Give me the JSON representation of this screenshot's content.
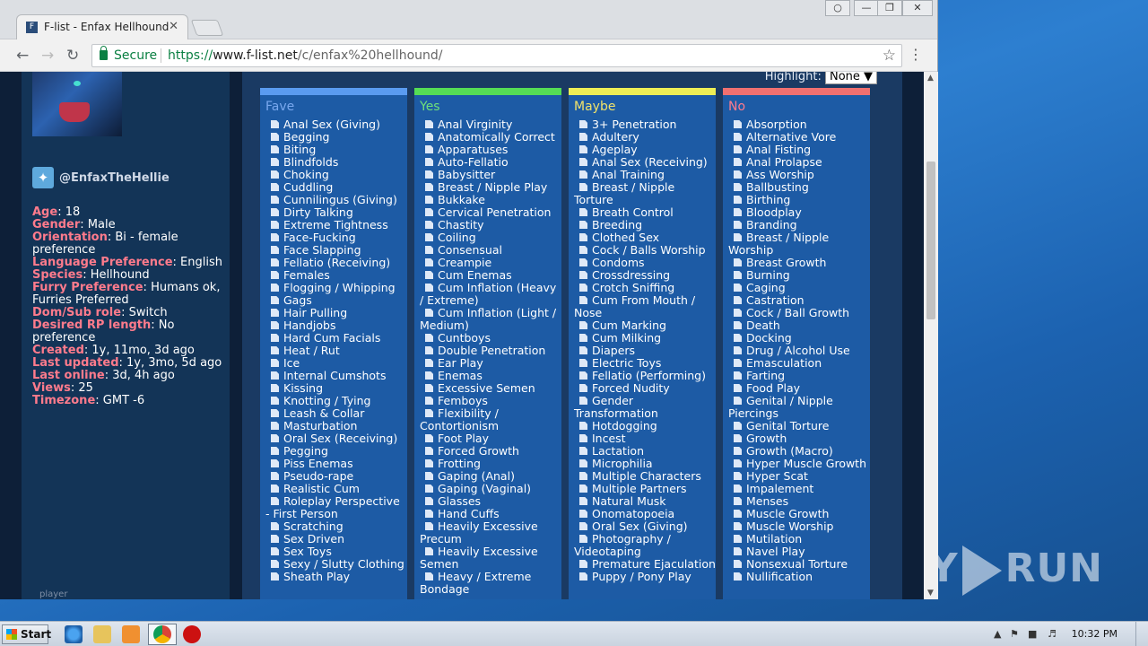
{
  "browser": {
    "tab_title": "F-list - Enfax Hellhound",
    "tab_close": "✕",
    "secure_label": "Secure",
    "url_scheme": "https://",
    "url_host": "www.f-list.net",
    "url_path": "/c/enfax%20hellhound/"
  },
  "sidebar": {
    "twitter_handle": "@EnfaxTheHellie",
    "info": [
      {
        "key": "Age",
        "value": "18"
      },
      {
        "key": "Gender",
        "value": "Male"
      },
      {
        "key": "Orientation",
        "value": "Bi - female preference"
      },
      {
        "key": "Language Preference",
        "value": "English"
      },
      {
        "key": "Species",
        "value": "Hellhound"
      },
      {
        "key": "Furry Preference",
        "value": "Humans ok, Furries Preferred"
      },
      {
        "key": "Dom/Sub role",
        "value": "Switch"
      },
      {
        "key": "Desired RP length",
        "value": "No preference"
      },
      {
        "key": "Created",
        "value": "1y, 11mo, 3d ago"
      },
      {
        "key": "Last updated",
        "value": "1y, 3mo, 5d ago"
      },
      {
        "key": "Last online",
        "value": "3d, 4h ago"
      },
      {
        "key": "Views",
        "value": "25"
      },
      {
        "key": "Timezone",
        "value": "GMT -6"
      }
    ],
    "player_caption": "player"
  },
  "highlight": {
    "label": "Highlight:",
    "value": "None"
  },
  "columns": [
    {
      "title": "Fave",
      "color": "#5a9bf0",
      "title_color": "#79a8ee",
      "items": [
        "Anal Sex (Giving)",
        "Begging",
        "Biting",
        "Blindfolds",
        "Choking",
        "Cuddling",
        "Cunnilingus (Giving)",
        "Dirty Talking",
        "Extreme Tightness",
        "Face-Fucking",
        "Face Slapping",
        "Fellatio (Receiving)",
        "Females",
        "Flogging / Whipping",
        "Gags",
        "Hair Pulling",
        "Handjobs",
        "Hard Cum Facials",
        "Heat / Rut",
        "Ice",
        "Internal Cumshots",
        "Kissing",
        "Knotting / Tying",
        "Leash & Collar",
        "Masturbation",
        "Oral Sex (Receiving)",
        "Pegging",
        "Piss Enemas",
        "Pseudo-rape",
        "Realistic Cum",
        "Roleplay Perspective - First Person",
        "Scratching",
        "Sex Driven",
        "Sex Toys",
        "Sexy / Slutty Clothing",
        "Sheath Play"
      ]
    },
    {
      "title": "Yes",
      "color": "#55dd55",
      "title_color": "#6fe07a",
      "items": [
        "Anal Virginity",
        "Anatomically Correct",
        "Apparatuses",
        "Auto-Fellatio",
        "Babysitter",
        "Breast / Nipple Play",
        "Bukkake",
        "Cervical Penetration",
        "Chastity",
        "Coiling",
        "Consensual",
        "Creampie",
        "Cum Enemas",
        "Cum Inflation (Heavy / Extreme)",
        "Cum Inflation (Light / Medium)",
        "Cuntboys",
        "Double Penetration",
        "Ear Play",
        "Enemas",
        "Excessive Semen",
        "Femboys",
        "Flexibility / Contortionism",
        "Foot Play",
        "Forced Growth",
        "Frotting",
        "Gaping (Anal)",
        "Gaping (Vaginal)",
        "Glasses",
        "Hand Cuffs",
        "Heavily Excessive Precum",
        "Heavily Excessive Semen",
        "Heavy / Extreme Bondage"
      ]
    },
    {
      "title": "Maybe",
      "color": "#eeee55",
      "title_color": "#f0e26a",
      "items": [
        "3+ Penetration",
        "Adultery",
        "Ageplay",
        "Anal Sex (Receiving)",
        "Anal Training",
        "Breast / Nipple Torture",
        "Breath Control",
        "Breeding",
        "Clothed Sex",
        "Cock / Balls Worship",
        "Condoms",
        "Crossdressing",
        "Crotch Sniffing",
        "Cum From Mouth / Nose",
        "Cum Marking",
        "Cum Milking",
        "Diapers",
        "Electric Toys",
        "Fellatio (Performing)",
        "Forced Nudity",
        "Gender Transformation",
        "Hotdogging",
        "Incest",
        "Lactation",
        "Microphilia",
        "Multiple Characters",
        "Multiple Partners",
        "Natural Musk",
        "Onomatopoeia",
        "Oral Sex (Giving)",
        "Photography / Videotaping",
        "Premature Ejaculation",
        "Puppy / Pony Play"
      ]
    },
    {
      "title": "No",
      "color": "#f07070",
      "title_color": "#ff7b8c",
      "items": [
        "Absorption",
        "Alternative Vore",
        "Anal Fisting",
        "Anal Prolapse",
        "Ass Worship",
        "Ballbusting",
        "Birthing",
        "Bloodplay",
        "Branding",
        "Breast / Nipple Worship",
        "Breast Growth",
        "Burning",
        "Caging",
        "Castration",
        "Cock / Ball Growth",
        "Death",
        "Docking",
        "Drug / Alcohol Use",
        "Emasculation",
        "Farting",
        "Food Play",
        "Genital / Nipple Piercings",
        "Genital Torture",
        "Growth",
        "Growth (Macro)",
        "Hyper Muscle Growth",
        "Hyper Scat",
        "Impalement",
        "Menses",
        "Muscle Growth",
        "Muscle Worship",
        "Mutilation",
        "Navel Play",
        "Nonsexual Torture",
        "Nullification"
      ]
    }
  ],
  "taskbar": {
    "start_label": "Start",
    "clock": "10:32 PM"
  },
  "watermark": {
    "left": "ANY",
    "right": "RUN"
  }
}
